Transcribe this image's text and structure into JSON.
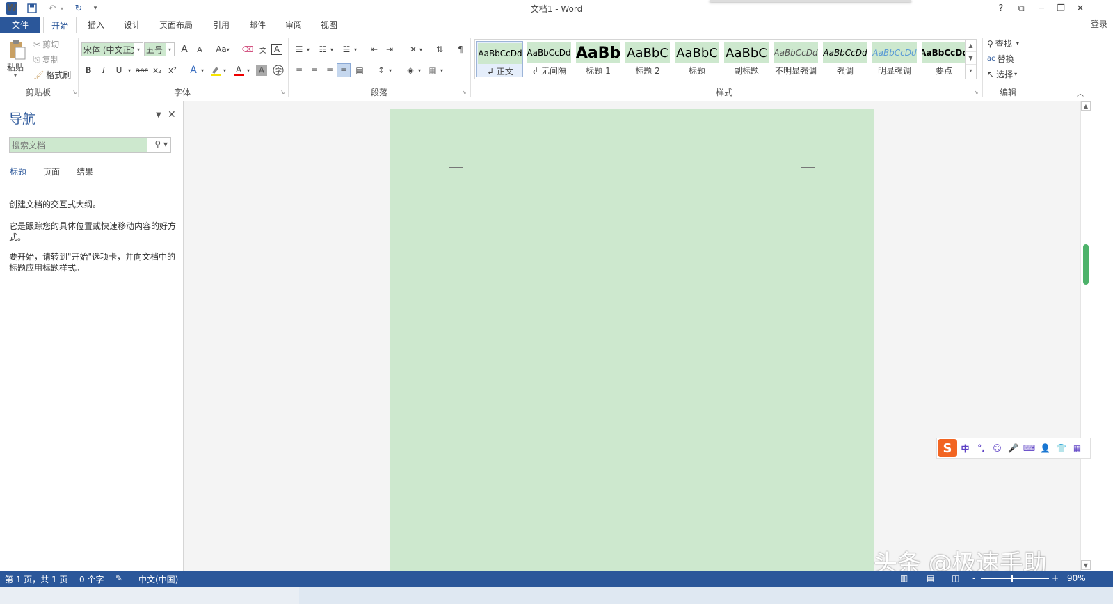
{
  "titlebar": {
    "title": "文档1 - Word",
    "app_icon": "W",
    "help": "?",
    "restore_ribbon": "⧉",
    "minimize": "─",
    "maximize": "❐",
    "close": "✕",
    "qa_dd": "▾"
  },
  "tabs": {
    "file": "文件",
    "items": [
      "开始",
      "插入",
      "设计",
      "页面布局",
      "引用",
      "邮件",
      "审阅",
      "视图"
    ],
    "login": "登录"
  },
  "clipboard": {
    "paste": "粘贴",
    "cut": "剪切",
    "copy": "复制",
    "format_painter": "格式刷",
    "label": "剪贴板"
  },
  "font": {
    "name": "宋体 (中文正文",
    "size": "五号",
    "grow": "A",
    "shrink": "A",
    "change_case": "Aa",
    "bold": "B",
    "italic": "I",
    "underline": "U",
    "strike": "abc",
    "sub": "x₂",
    "sup": "x²",
    "label": "字体"
  },
  "paragraph": {
    "label": "段落"
  },
  "styles": {
    "items": [
      {
        "preview": "AaBbCcDd",
        "name": "↲ 正文"
      },
      {
        "preview": "AaBbCcDd",
        "name": "↲ 无间隔"
      },
      {
        "preview": "AaBb",
        "name": "标题 1"
      },
      {
        "preview": "AaBbC",
        "name": "标题 2"
      },
      {
        "preview": "AaBbC",
        "name": "标题"
      },
      {
        "preview": "AaBbC",
        "name": "副标题"
      },
      {
        "preview": "AaBbCcDd",
        "name": "不明显强调"
      },
      {
        "preview": "AaBbCcDd",
        "name": "强调"
      },
      {
        "preview": "AaBbCcDd",
        "name": "明显强调"
      },
      {
        "preview": "AaBbCcDd",
        "name": "要点"
      }
    ],
    "label": "样式"
  },
  "editing": {
    "find": "查找",
    "replace": "替换",
    "select": "选择",
    "label": "编辑"
  },
  "nav": {
    "title": "导航",
    "search_placeholder": "搜索文档",
    "tabs": [
      "标题",
      "页面",
      "结果"
    ],
    "text1": "创建文档的交互式大纲。",
    "text2": "它是跟踪您的具体位置或快速移动内容的好方式。",
    "text3": "要开始，请转到\"开始\"选项卡，并向文档中的标题应用标题样式。"
  },
  "ime": {
    "logo": "S",
    "items": [
      "中",
      "°,",
      "☺",
      "🎤",
      "⌨",
      "👤",
      "👕",
      "▦"
    ]
  },
  "watermark": "头条 @极速手助",
  "status": {
    "page": "第 1 页，共 1 页",
    "words": "0 个字",
    "lang": "中文(中国)",
    "zoom": "90%",
    "zoom_minus": "-",
    "zoom_plus": "+"
  },
  "colors": {
    "accent": "#2b579a",
    "page_bg": "#cde8ce",
    "scroll_thumb": "#4db26a"
  }
}
